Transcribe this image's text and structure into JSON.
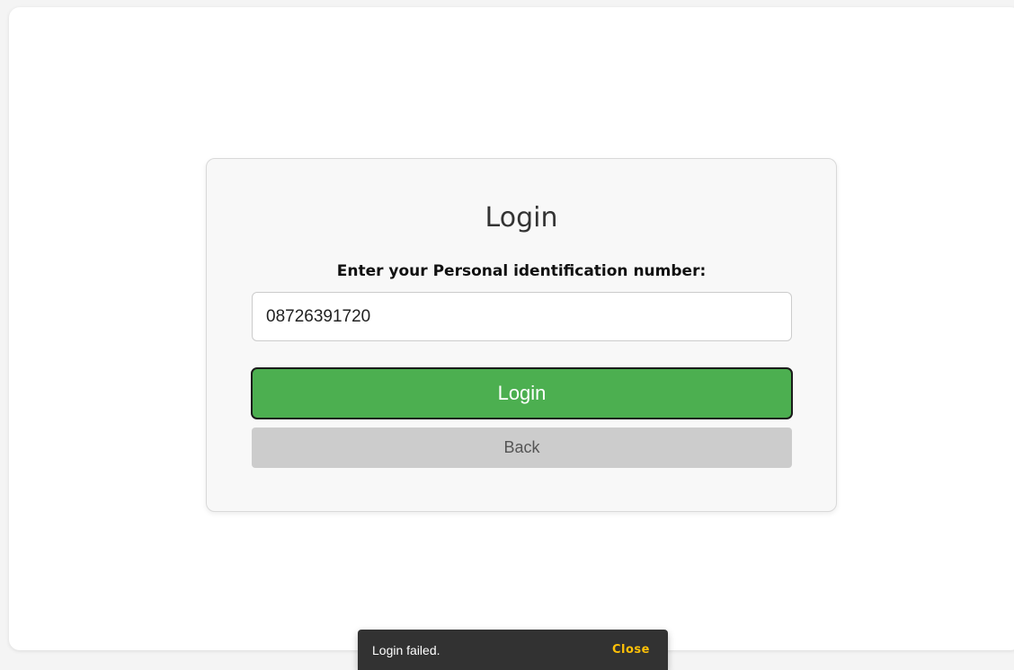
{
  "login_card": {
    "title": "Login",
    "pin_label": "Enter your Personal identification number:",
    "pin_value": "08726391720",
    "login_button_label": "Login",
    "back_button_label": "Back"
  },
  "snackbar": {
    "message": "Login failed.",
    "action_label": "Close"
  },
  "colors": {
    "login_button": "#4caf50",
    "back_button": "#cccccc",
    "snackbar_background": "#323232",
    "snackbar_action": "#ffc107"
  }
}
